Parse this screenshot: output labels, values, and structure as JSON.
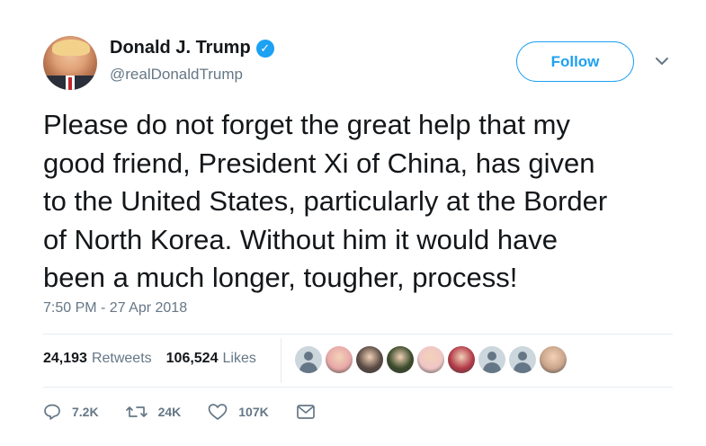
{
  "author": {
    "display_name": "Donald J. Trump",
    "handle": "@realDonaldTrump",
    "verified_badge": "✓"
  },
  "follow_label": "Follow",
  "tweet": {
    "lines": [
      "Please do not forget the great help that my",
      "good friend, President Xi of China, has given",
      "to the United States, particularly at the Border",
      "of North Korea. Without him it would have",
      "been a much longer, tougher, process!"
    ],
    "timestamp": "7:50 PM - 27 Apr 2018"
  },
  "stats": {
    "retweets_count": "24,193",
    "retweets_label": "Retweets",
    "likes_count": "106,524",
    "likes_label": "Likes"
  },
  "liker_avatars": [
    {
      "kind": "default",
      "color": "#ccd6dd"
    },
    {
      "kind": "photo",
      "color": "#e8a8a8"
    },
    {
      "kind": "photo",
      "color": "#5a4a44"
    },
    {
      "kind": "photo",
      "color": "#3a4a2a"
    },
    {
      "kind": "photo",
      "color": "#f0c6c6"
    },
    {
      "kind": "photo",
      "color": "#b23a48"
    },
    {
      "kind": "default",
      "color": "#ccd6dd"
    },
    {
      "kind": "default",
      "color": "#ccd6dd"
    },
    {
      "kind": "photo",
      "color": "#c9a48a"
    }
  ],
  "actions": {
    "reply_count": "7.2K",
    "retweet_count": "24K",
    "like_count": "107K"
  },
  "icons": {
    "reply": "reply-icon",
    "retweet": "retweet-icon",
    "like": "heart-icon",
    "message": "direct-message-icon",
    "menu": "chevron-down-icon"
  },
  "colors": {
    "accent": "#1da1f2",
    "secondary_text": "#657786",
    "divider": "#e6ecf0"
  }
}
